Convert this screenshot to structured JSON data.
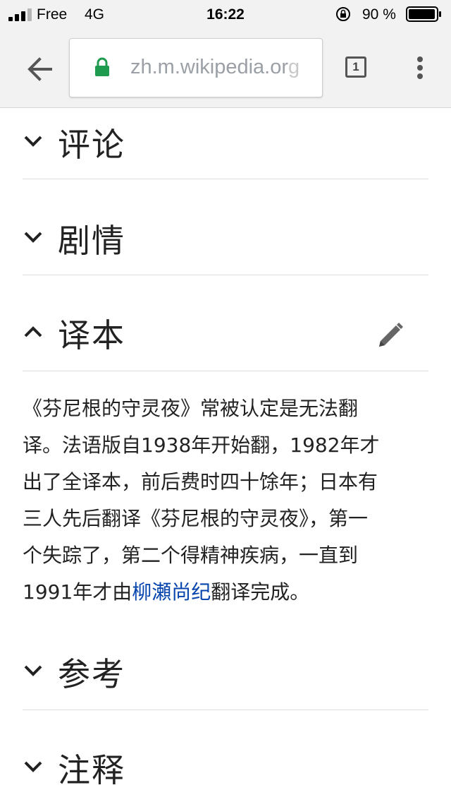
{
  "status_bar": {
    "carrier": "Free",
    "network": "4G",
    "time": "16:22",
    "battery_percent": "90 %",
    "icons": [
      "signal-icon",
      "rotation-lock-icon",
      "battery-icon"
    ]
  },
  "toolbar": {
    "url_main": "zh.m.wikipedia.or",
    "url_fade": "g",
    "tab_count": "1",
    "icons": [
      "back-arrow-icon",
      "lock-icon",
      "tabs-icon",
      "overflow-menu-icon"
    ],
    "lock_color": "#1e9b4f"
  },
  "sections": [
    {
      "title": "评论",
      "expanded": false
    },
    {
      "title": "剧情",
      "expanded": false
    },
    {
      "title": "译本",
      "expanded": true
    },
    {
      "title": "参考",
      "expanded": false
    },
    {
      "title": "注释",
      "expanded": false
    }
  ],
  "translation_section": {
    "lines": [
      "《芬尼根的守灵夜》常被认定是无法翻",
      "译。法语版自1938年开始翻，1982年才",
      "出了全译本，前后费时四十馀年；日本有",
      "三人先后翻译《芬尼根的守灵夜》，第一",
      "个失踪了，第二个得精神疾病，一直到"
    ],
    "last_line_before_link": "1991年才由",
    "link_text": "柳瀬尚纪",
    "last_line_after_link": "翻译完成。",
    "link_color": "#0645ad"
  }
}
